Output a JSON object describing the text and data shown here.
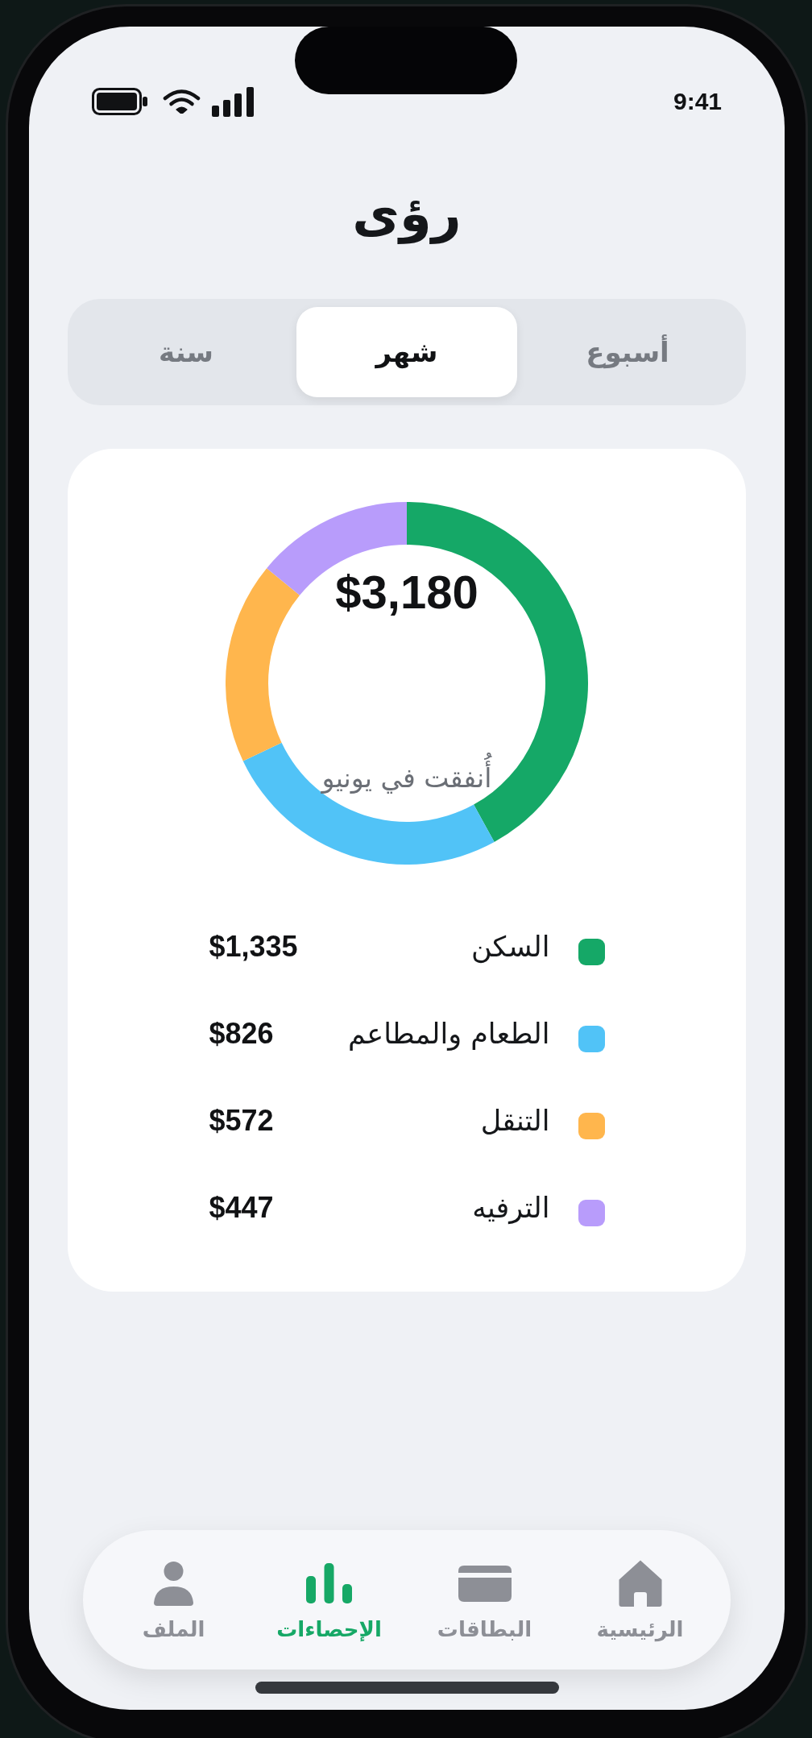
{
  "status_bar": {
    "time": "9:41"
  },
  "title": "رؤى",
  "tabs": [
    {
      "label": "أسبوع",
      "selected": false
    },
    {
      "label": "شهر",
      "selected": true
    },
    {
      "label": "سنة",
      "selected": false
    }
  ],
  "summary_card": {
    "total": "$3,180",
    "caption": "أُنفقت في يونيو",
    "chart_data": {
      "type": "donut",
      "categories": [
        "السكن",
        "الطعام والمطاعم",
        "التنقل",
        "الترفيه"
      ],
      "values": [
        41.98,
        25.97,
        17.99,
        14.06
      ],
      "legend": "bottom"
    },
    "legend": [
      {
        "amount": "$1,335",
        "color": "#15a867"
      },
      {
        "amount": "$826",
        "color": "#51c3f7"
      },
      {
        "amount": "$572",
        "color": "#ffb64d"
      },
      {
        "amount": "$447",
        "color": "#b89cfb"
      }
    ]
  },
  "bottom_nav": [
    {
      "label": "الرئيسية",
      "kind": "home",
      "selected": false
    },
    {
      "label": "البطاقات",
      "kind": "card",
      "selected": false
    },
    {
      "label": "الإحصاءات",
      "kind": "stats",
      "selected": true
    },
    {
      "label": "الملف",
      "kind": "profile",
      "selected": false
    }
  ]
}
